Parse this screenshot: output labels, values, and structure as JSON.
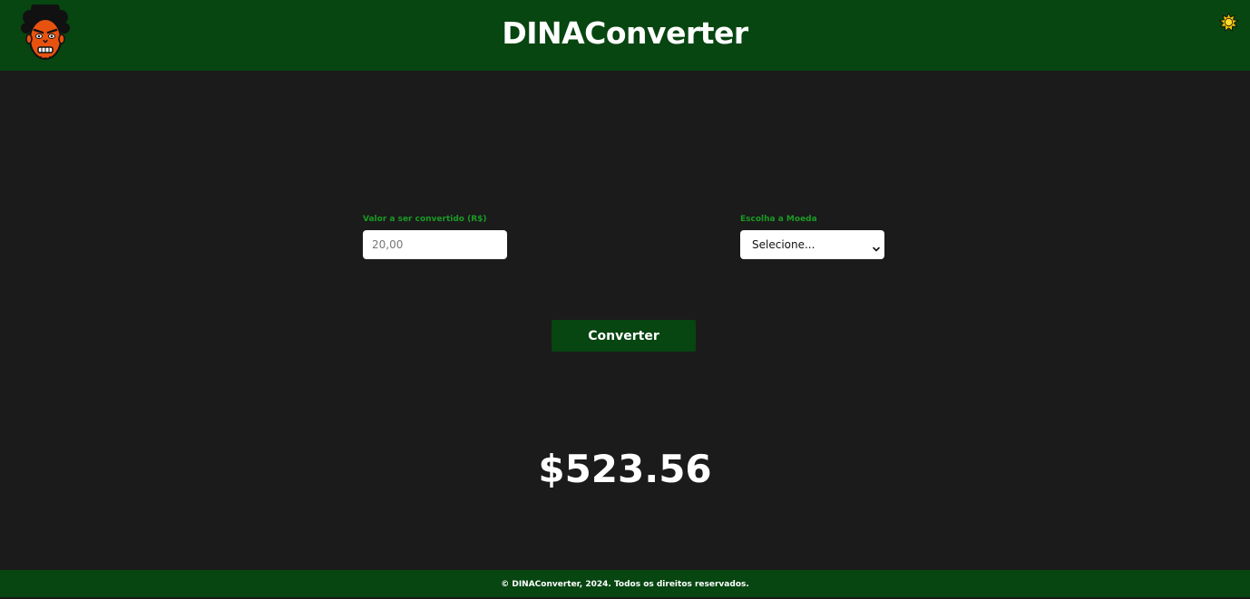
{
  "header": {
    "title": "DINAConverter",
    "logo_icon": "avatar-face-icon",
    "theme_icon": "sun-icon"
  },
  "form": {
    "amount_label": "Valor a ser convertido (R$)",
    "amount_placeholder": "20,00",
    "amount_value": "",
    "currency_label": "Escolha a Moeda",
    "currency_selected": "Selecione...",
    "currency_chevron_icon": "chevron-down-icon",
    "convert_label": "Converter"
  },
  "result": {
    "value": "$523.56"
  },
  "footer": {
    "text": "© DINAConverter, 2024. Todos os direitos reservados."
  },
  "colors": {
    "brand_green": "#074511",
    "label_green": "#1a9a24",
    "background": "#1b1b1b",
    "text": "#ffffff",
    "sun": "#f4c400"
  }
}
